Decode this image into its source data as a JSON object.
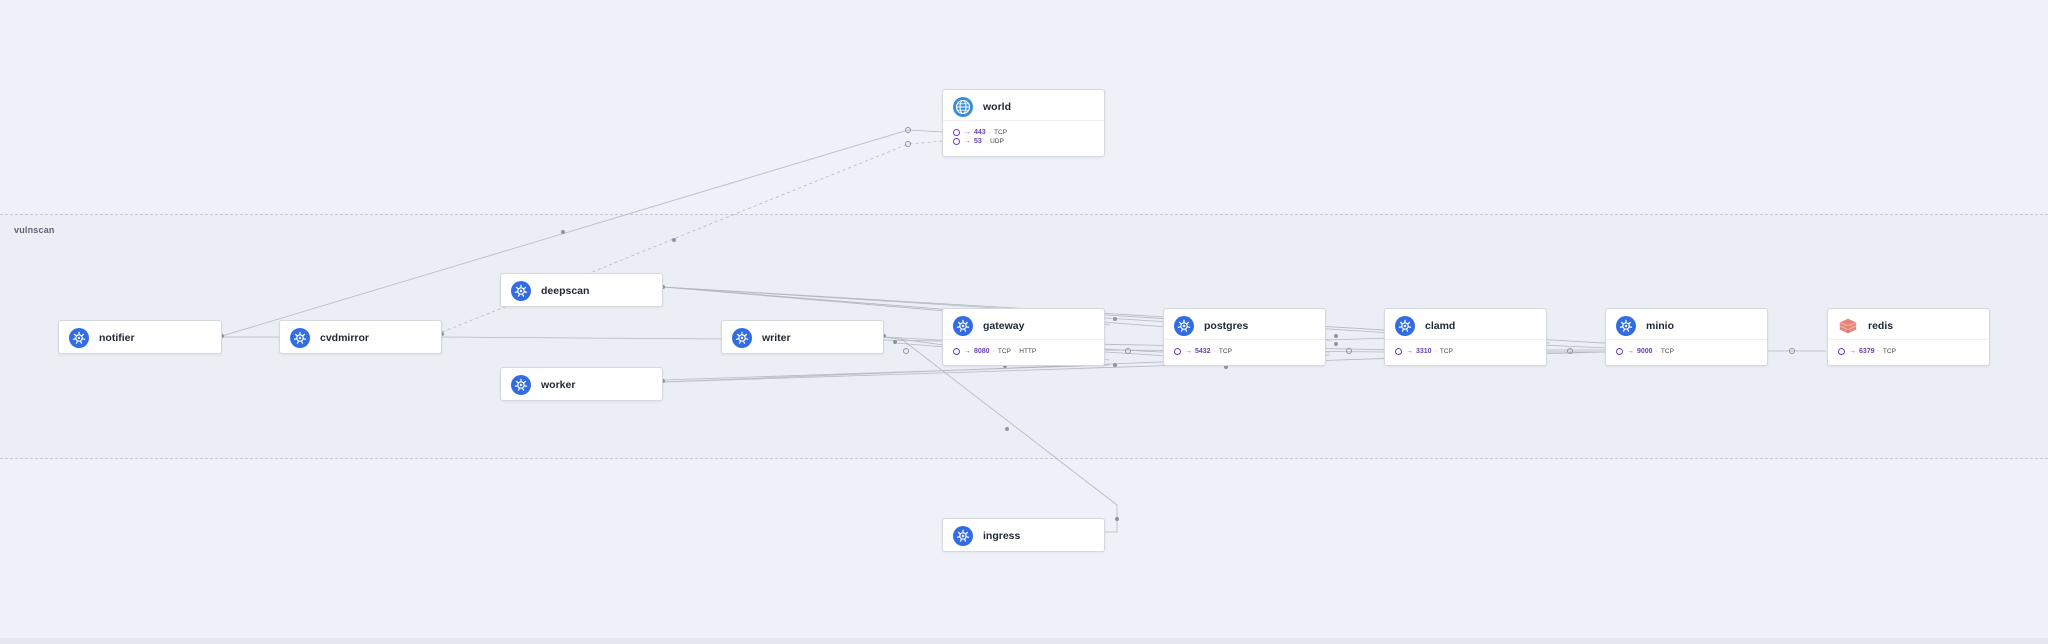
{
  "namespace": {
    "label": "vulnscan"
  },
  "nodes": {
    "world": {
      "title": "world",
      "icon": "globe-icon",
      "ports": [
        {
          "num": "443",
          "proto": "TCP"
        },
        {
          "num": "53",
          "proto": "UDP"
        }
      ]
    },
    "notifier": {
      "title": "notifier",
      "icon": "kubernetes-icon"
    },
    "cvdmirror": {
      "title": "cvdmirror",
      "icon": "kubernetes-icon"
    },
    "deepscan": {
      "title": "deepscan",
      "icon": "kubernetes-icon"
    },
    "writer": {
      "title": "writer",
      "icon": "kubernetes-icon"
    },
    "worker": {
      "title": "worker",
      "icon": "kubernetes-icon"
    },
    "gateway": {
      "title": "gateway",
      "icon": "kubernetes-icon",
      "ports": [
        {
          "num": "8080",
          "proto": "TCP",
          "extra": "HTTP"
        }
      ]
    },
    "postgres": {
      "title": "postgres",
      "icon": "kubernetes-icon",
      "ports": [
        {
          "num": "5432",
          "proto": "TCP"
        }
      ]
    },
    "clamd": {
      "title": "clamd",
      "icon": "kubernetes-icon",
      "ports": [
        {
          "num": "3310",
          "proto": "TCP"
        }
      ]
    },
    "minio": {
      "title": "minio",
      "icon": "kubernetes-icon",
      "ports": [
        {
          "num": "9000",
          "proto": "TCP"
        }
      ]
    },
    "redis": {
      "title": "redis",
      "icon": "redis-icon",
      "ports": [
        {
          "num": "6379",
          "proto": "TCP"
        }
      ]
    },
    "ingress": {
      "title": "ingress",
      "icon": "kubernetes-icon"
    }
  },
  "colors": {
    "kubernetes": "#326ce5",
    "port": "#6b3fb8",
    "edge": "#a9aeb8",
    "redis": "#e8867c"
  }
}
